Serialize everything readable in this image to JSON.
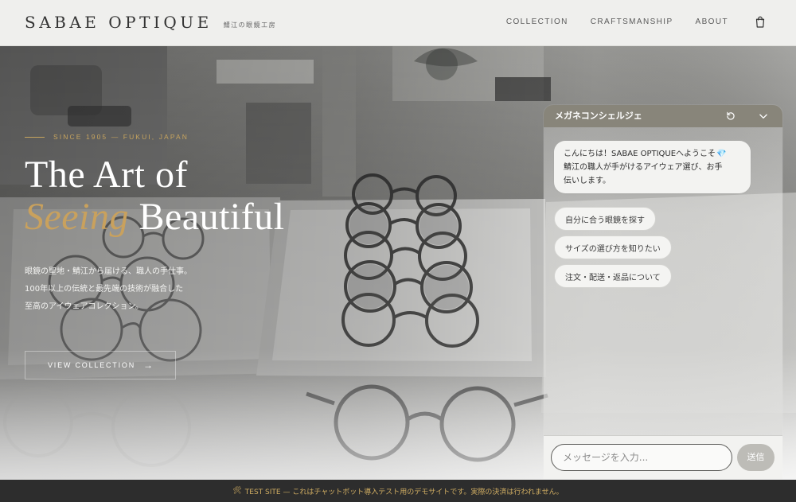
{
  "site": {
    "brand": "SABAE OPTIQUE",
    "tagline": "鯖江の眼鏡工房",
    "nav": [
      {
        "label": "COLLECTION"
      },
      {
        "label": "CRAFTSMANSHIP"
      },
      {
        "label": "ABOUT"
      }
    ],
    "cart_icon": "cart-icon"
  },
  "hero": {
    "eyebrow": "SINCE 1905 — FUKUI, JAPAN",
    "title_line1": "The Art of",
    "title_accent": "Seeing",
    "title_rest": " Beautiful",
    "description": [
      "眼鏡の聖地・鯖江から届ける、職人の手仕事。",
      "100年以上の伝統と最先端の技術が融合した",
      "至高のアイウェアコレクション。"
    ],
    "cta_label": "VIEW COLLECTION",
    "cta_arrow": "→"
  },
  "chat": {
    "title": "メガネコンシェルジェ",
    "refresh_icon": "refresh-icon",
    "collapse_icon": "chevron-down-icon",
    "greeting_line1": "こんにちは！SABAE OPTIQUEへようこそ",
    "greeting_icon": "💎",
    "greeting_line2": "鯖江の職人が手がけるアイウェア選び、お手",
    "greeting_line3": "伝いします。",
    "quick_replies": [
      {
        "label": "自分に合う眼鏡を探す"
      },
      {
        "label": "サイズの選び方を知りたい"
      },
      {
        "label": "注文・配送・返品について"
      }
    ],
    "input_placeholder": "メッセージを入力...",
    "send_label": "送信"
  },
  "banner": {
    "icon": "🛠",
    "text": "TEST SITE — これはチャットボット導入テスト用のデモサイトです。実際の決済は行われません。"
  },
  "colors": {
    "gold": "#c7a45e",
    "chat_header": "#88857a",
    "banner_bg": "#2d2d2d"
  }
}
